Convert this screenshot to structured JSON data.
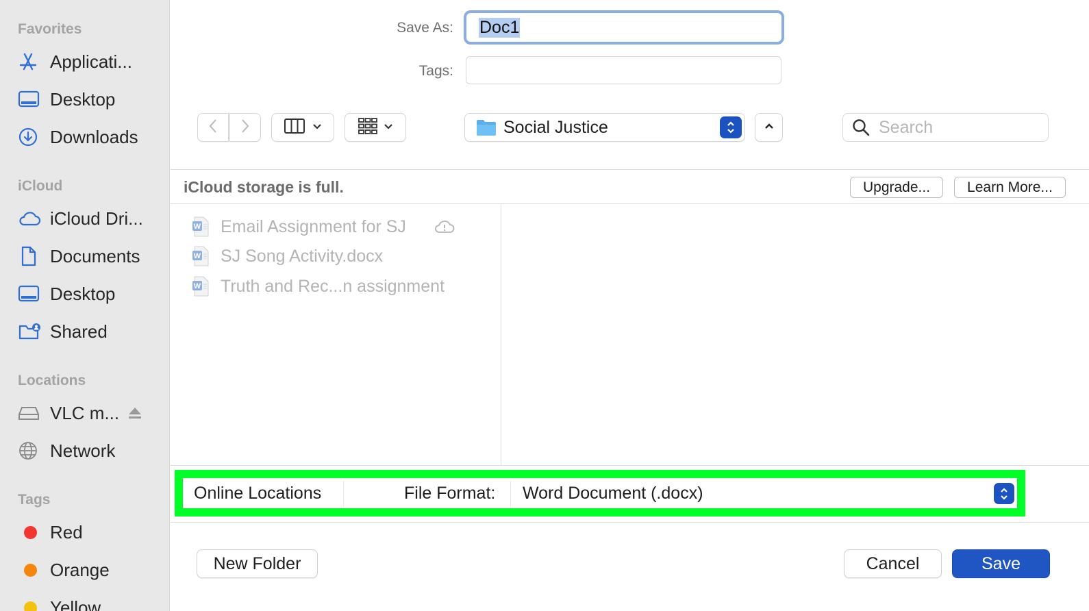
{
  "sidebar": {
    "favorites_header": "Favorites",
    "favorites": [
      {
        "label": "Applicati...",
        "icon": "applications-icon"
      },
      {
        "label": "Desktop",
        "icon": "desktop-icon"
      },
      {
        "label": "Downloads",
        "icon": "downloads-icon"
      }
    ],
    "icloud_header": "iCloud",
    "icloud": [
      {
        "label": "iCloud Dri...",
        "icon": "icloud-drive-icon"
      },
      {
        "label": "Documents",
        "icon": "document-icon"
      },
      {
        "label": "Desktop",
        "icon": "desktop-icon"
      },
      {
        "label": "Shared",
        "icon": "shared-folder-icon"
      }
    ],
    "locations_header": "Locations",
    "locations": [
      {
        "label": "VLC m...",
        "icon": "drive-icon"
      },
      {
        "label": "Network",
        "icon": "network-icon"
      }
    ],
    "tags_header": "Tags",
    "tags": [
      {
        "label": "Red",
        "color": "#f2362f"
      },
      {
        "label": "Orange",
        "color": "#f5860d"
      },
      {
        "label": "Yellow",
        "color": "#f4c20d"
      }
    ]
  },
  "form": {
    "save_as_label": "Save As:",
    "save_as_value": "Doc1",
    "tags_label": "Tags:",
    "tags_value": ""
  },
  "toolbar": {
    "folder_name": "Social Justice",
    "search_placeholder": "Search"
  },
  "icloud_notice": {
    "message": "iCloud storage is full.",
    "upgrade_label": "Upgrade...",
    "learn_more_label": "Learn More..."
  },
  "files": [
    {
      "name": "Email Assignment for SJ",
      "cloud_alert": true
    },
    {
      "name": "SJ Song Activity.docx",
      "cloud_alert": false
    },
    {
      "name": "Truth and Rec...n assignment",
      "cloud_alert": false
    }
  ],
  "format_bar": {
    "online_locations_label": "Online Locations",
    "file_format_label": "File Format:",
    "file_format_value": "Word Document (.docx)",
    "highlight_color": "#00ff27"
  },
  "footer": {
    "new_folder_label": "New Folder",
    "cancel_label": "Cancel",
    "save_label": "Save"
  },
  "colors": {
    "accent": "#1f56c3",
    "sidebar_bg": "#e8e8e8",
    "icon_blue": "#2f6fd4"
  }
}
